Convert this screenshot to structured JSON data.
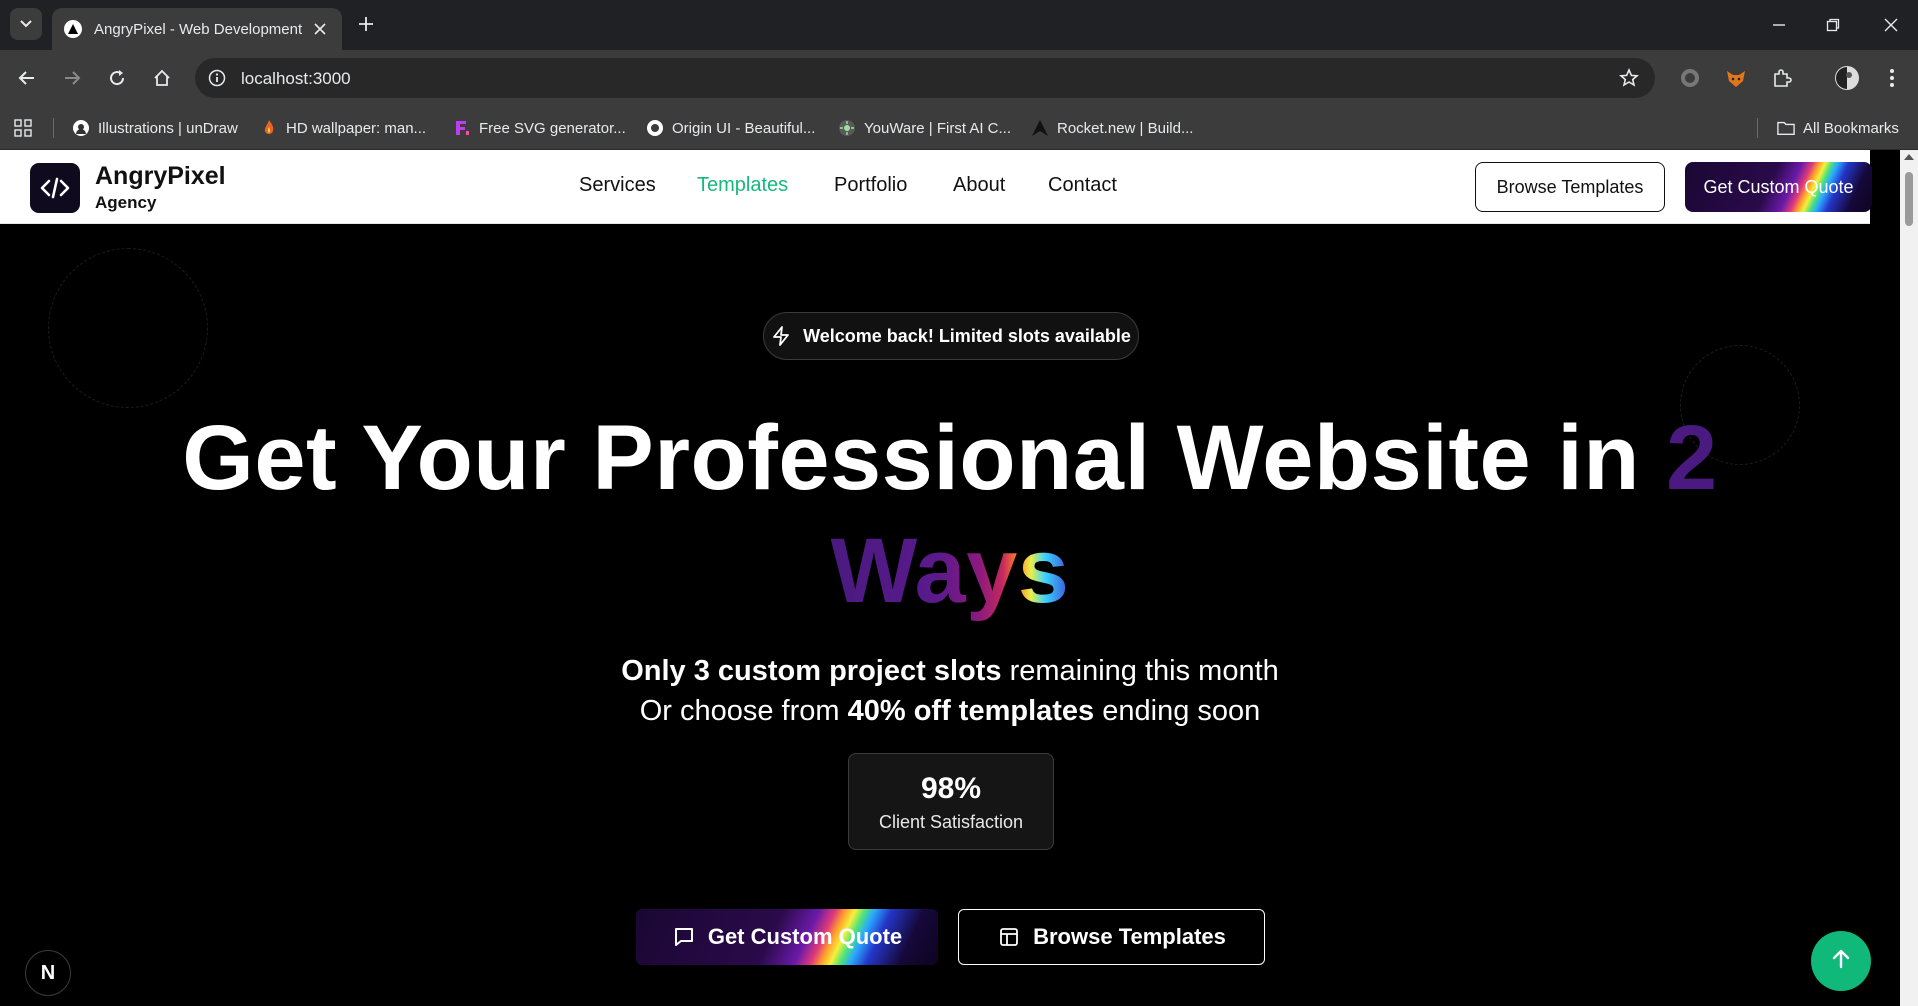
{
  "browser": {
    "tab_title": "AngryPixel - Web Development",
    "url": "localhost:3000",
    "bookmarks": [
      {
        "label": "Illustrations | unDraw",
        "icon": "undraw-icon"
      },
      {
        "label": "HD wallpaper: man...",
        "icon": "flame-icon"
      },
      {
        "label": "Free SVG generator...",
        "icon": "svg-generator-icon"
      },
      {
        "label": "Origin UI - Beautiful...",
        "icon": "origin-ui-icon"
      },
      {
        "label": "YouWare | First AI C...",
        "icon": "youware-icon"
      },
      {
        "label": "Rocket.new | Build...",
        "icon": "rocket-icon"
      }
    ],
    "all_bookmarks_label": "All Bookmarks"
  },
  "header": {
    "brand_name": "AngryPixel",
    "brand_sub": "Agency",
    "nav": [
      {
        "label": "Services",
        "active": false
      },
      {
        "label": "Templates",
        "active": true
      },
      {
        "label": "Portfolio",
        "active": false
      },
      {
        "label": "About",
        "active": false
      },
      {
        "label": "Contact",
        "active": false
      }
    ],
    "browse_button": "Browse Templates",
    "quote_button": "Get Custom Quote"
  },
  "hero": {
    "badge": "Welcome back! Limited slots available",
    "headline_main": "Get Your Professional Website in",
    "headline_num": "2",
    "headline_end": "Ways",
    "sub1_bold": "Only 3 custom project slots",
    "sub1_rest": "remaining this month",
    "sub2_start": "Or choose from",
    "sub2_bold": "40% off templates",
    "sub2_end": "ending soon",
    "stat_value": "98%",
    "stat_label": "Client Satisfaction",
    "cta_primary": "Get Custom Quote",
    "cta_secondary": "Browse Templates"
  },
  "misc": {
    "next_badge": "N"
  },
  "colors": {
    "accent_green": "#16b97d",
    "to_top_button": "#10b97a",
    "headline_purple": "#4a1a80"
  }
}
